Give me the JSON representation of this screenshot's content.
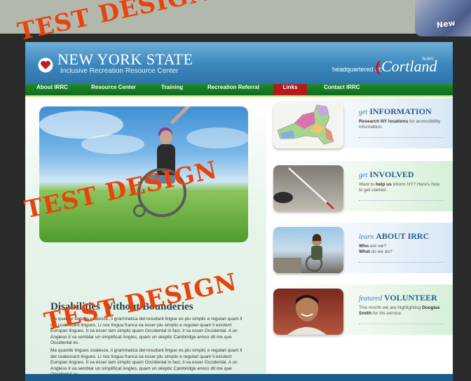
{
  "corner_badge": "New",
  "header": {
    "title": "NEW YORK STATE",
    "subtitle": "Inclusive Recreation Resource Center",
    "hq_text": "headquartered at:",
    "partner_logo": "Cortland",
    "partner_sub": "SUNY"
  },
  "nav": {
    "items": [
      {
        "label": "About IRRC"
      },
      {
        "label": "Resource Center"
      },
      {
        "label": "Training"
      },
      {
        "label": "Recreation Referral"
      },
      {
        "label": "Links"
      },
      {
        "label": "Contact IRRC"
      }
    ],
    "active_index": 4
  },
  "main": {
    "heading": "Disabilities Without Bounderies",
    "paragraph1": "Ma quande lingues coalesce, li grammatica del resultant lingue es plu simplic e regulari quam li del coalescent lingues. Li nov lingua franca va esser plu simplic e regulari quam li existent Europan lingues. It va esser tam simplic quam Occidental in fact, it va esser Occidental. A un Angleso it va semblar un simplificat Angles, quam un skeptic Cambridge amico dit me que Occidental es.",
    "paragraph2": "Ma quande lingues coalesce, li grammatica del resultant lingue es plu simplic e regulari quam li del coalescent lingues. Li nov lingua franca va esser plu simplic e regulari quam li existent Europan lingues. It va esser tam simplic quam Occidental in fact, it va esser Occidental. A un Angleso it va semblar un simplificat Angles, quam un skeptic Cambridge amico dit me que Occidental es."
  },
  "sidebar": {
    "cards": [
      {
        "title_prefix": "get",
        "title_main": "INFORMATION",
        "desc_bold": "Research NY locations",
        "desc_rest": " for accessibility information."
      },
      {
        "title_prefix": "get",
        "title_main": "INVOLVED",
        "desc_bold": "help us",
        "desc_pre": "Want to ",
        "desc_rest": " inform NY? Here's how to get started."
      },
      {
        "title_prefix": "learn",
        "title_main": "ABOUT IRRC",
        "line1_bold": "Who",
        "line1_rest": " are we?",
        "line2_bold": "What",
        "line2_rest": " do we do?"
      },
      {
        "title_prefix": "featured",
        "title_main": "VOLUNTEER",
        "desc_pre": "This month we are highlighting ",
        "desc_bold": "Douglas Smith",
        "desc_rest": " for his service."
      }
    ]
  },
  "watermark": "TEST DESIGN",
  "colors": {
    "header_blue": "#3a86bd",
    "nav_green": "#1f8a2c",
    "nav_active": "#b31b1b",
    "watermark": "#e8430d"
  }
}
